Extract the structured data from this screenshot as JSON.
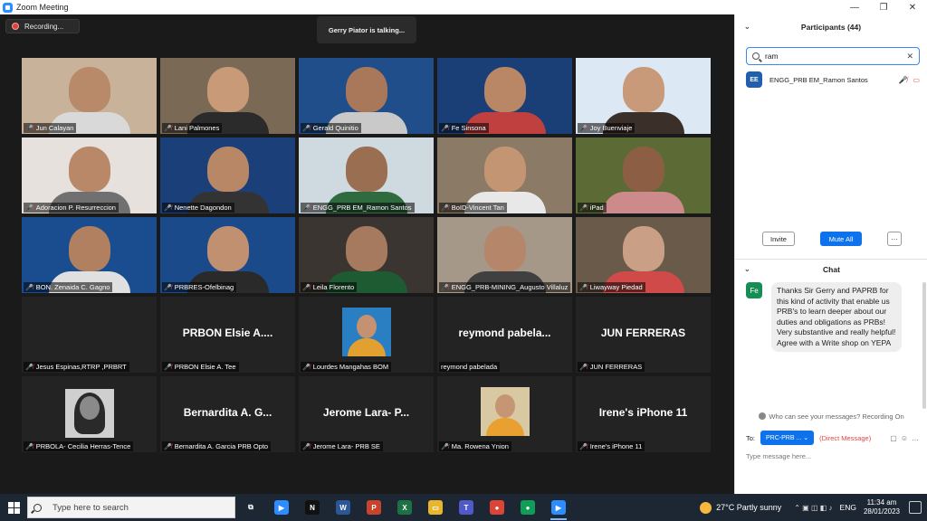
{
  "window": {
    "title": "Zoom Meeting",
    "min": "—",
    "restore": "❐",
    "close": "✕"
  },
  "meeting": {
    "recording_label": "Recording...",
    "talking_text": "Gerry Piator is talking..."
  },
  "tiles": [
    {
      "name": "Jun Calayan",
      "kind": "video",
      "bg": "#c9b29a",
      "skin": "#b88a6a",
      "shirt": "#d9d9d9"
    },
    {
      "name": "Lani Palmones",
      "kind": "video",
      "bg": "#7a6a55",
      "skin": "#c99a78",
      "shirt": "#2b2b2b"
    },
    {
      "name": "Gerald Quinitio",
      "kind": "video",
      "bg": "#1f4e8a",
      "skin": "#a9785a",
      "shirt": "#c9c9c9"
    },
    {
      "name": "Fe Sinsona",
      "kind": "video",
      "bg": "#1a3f77",
      "skin": "#b98766",
      "shirt": "#c04040"
    },
    {
      "name": "Joy Buenviaje",
      "kind": "video",
      "bg": "#dce8f3",
      "skin": "#c89a7a",
      "shirt": "#3b2f2a"
    },
    {
      "name": "Adoracion P. Resurreccion",
      "kind": "video",
      "bg": "#e6e1dc",
      "skin": "#b98868",
      "shirt": "#707070"
    },
    {
      "name": "Nenette Dagondon",
      "kind": "video",
      "bg": "#1b3f78",
      "skin": "#b88766",
      "shirt": "#333333"
    },
    {
      "name": "ENGG_PRB EM_Ramon Santos",
      "kind": "video",
      "bg": "#cfd9e0",
      "skin": "#9a6e50",
      "shirt": "#2f6b3e"
    },
    {
      "name": "BoID-Vincent Tan",
      "kind": "video",
      "bg": "#8a7a66",
      "skin": "#c49573",
      "shirt": "#e8e8e8"
    },
    {
      "name": "iPad",
      "kind": "video",
      "bg": "#5c6b35",
      "skin": "#8c5f45",
      "shirt": "#cc8a8a"
    },
    {
      "name": "BON. Zenaida C. Gagno",
      "kind": "video",
      "bg": "#1a4d90",
      "skin": "#b08060",
      "shirt": "#e0e0e0"
    },
    {
      "name": "PRBRES-Ofelbinag",
      "kind": "video",
      "bg": "#1a4a8a",
      "skin": "#c09070",
      "shirt": "#2a2a2a"
    },
    {
      "name": "Leila Florento",
      "kind": "video",
      "bg": "#3a3530",
      "skin": "#a57a5e",
      "shirt": "#1e5a32"
    },
    {
      "name": "ENGG_PRB-MINING_Augusto Villaluz",
      "kind": "video",
      "bg": "#a59888",
      "skin": "#b5866a",
      "shirt": "#404040"
    },
    {
      "name": "Liwayway Piedad",
      "kind": "video",
      "bg": "#6a5a4a",
      "skin": "#c9a085",
      "shirt": "#d04a4a"
    },
    {
      "name": "Jesus Espinas,RTRP ,PRBRT",
      "kind": "blank",
      "big": ""
    },
    {
      "name": "PRBON Elsie A. Tee",
      "kind": "blank",
      "big": "PRBON  Elsie  A...."
    },
    {
      "name": "Lourdes Mangahas BOM",
      "kind": "photo",
      "bg": "#2a7fc2",
      "skin": "#c49270",
      "shirt": "#e2a030"
    },
    {
      "name": "reymond pabelada",
      "kind": "blank",
      "big": "reymond  pabela...",
      "nomute": true
    },
    {
      "name": "JUN FERRERAS",
      "kind": "blank",
      "big": "JUN FERRERAS"
    },
    {
      "name": "PRBOLA- Cecilia Herras-Tence",
      "kind": "avatar"
    },
    {
      "name": "Bernardita A. Garcia PRB Opto",
      "kind": "blank",
      "big": "Bernardita  A.  G..."
    },
    {
      "name": "Jerome Lara- PRB SE",
      "kind": "blank",
      "big": "Jerome  Lara-  P..."
    },
    {
      "name": "Ma. Rowena Ynion",
      "kind": "photo",
      "bg": "#d9c9a3",
      "skin": "#c69674",
      "shirt": "#e8a030"
    },
    {
      "name": "Irene's iPhone 11",
      "kind": "blank",
      "big": "Irene's iPhone 11"
    }
  ],
  "sidebar": {
    "participants_title": "Participants (44)",
    "search_value": "ram",
    "participant": {
      "initials": "EE",
      "name": "ENGG_PRB EM_Ramon Santos"
    },
    "invite_label": "Invite",
    "mute_all_label": "Mute All",
    "more_label": "···",
    "chat_title": "Chat",
    "chat": {
      "sender_initials": "Fe",
      "message": "Thanks Sir Gerry and PAPRB for this kind of activity that enable us PRB's to learn deeper about our duties and obligations as PRBs! Very substantive and really helpful! Agree with a Write shop on YEPA"
    },
    "who_can_see": "Who can see your messages? Recording On",
    "to_label": "To:",
    "to_value": "PRC-PRB ...",
    "direct_message": "(Direct Message)",
    "input_placeholder": "Type message here..."
  },
  "taskbar": {
    "search_placeholder": "Type here to search",
    "apps": [
      {
        "id": "task-view",
        "label": "⧉",
        "color": "#1c2733"
      },
      {
        "id": "zoom",
        "label": "▶",
        "color": "#2d8cff"
      },
      {
        "id": "netflix",
        "label": "N",
        "color": "#111111"
      },
      {
        "id": "word",
        "label": "W",
        "color": "#2b5797"
      },
      {
        "id": "powerpoint",
        "label": "P",
        "color": "#c8432b"
      },
      {
        "id": "excel",
        "label": "X",
        "color": "#1e7145"
      },
      {
        "id": "file-explorer",
        "label": "▭",
        "color": "#e9b52b"
      },
      {
        "id": "teams",
        "label": "T",
        "color": "#5059c9"
      },
      {
        "id": "chrome",
        "label": "●",
        "color": "#db4437"
      },
      {
        "id": "chrome-profile",
        "label": "●",
        "color": "#0f9d58"
      },
      {
        "id": "zoom-active",
        "label": "▶",
        "color": "#2d8cff"
      }
    ],
    "weather": "27°C  Partly sunny",
    "lang": "ENG",
    "time": "11:34 am",
    "date": "28/01/2023"
  }
}
